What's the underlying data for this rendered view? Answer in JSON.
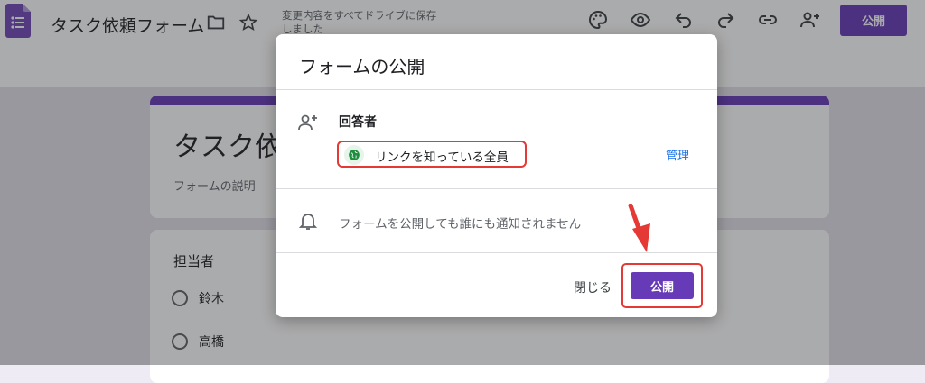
{
  "header": {
    "app_title": "タスク依頼フォーム",
    "save_status": "変更内容をすべてドライブに保存しました",
    "publish_label": "公開"
  },
  "form": {
    "title": "タスク依",
    "description": "フォームの説明",
    "question": {
      "title": "担当者",
      "options": [
        "鈴木",
        "高橋"
      ]
    }
  },
  "dialog": {
    "title": "フォームの公開",
    "responders_label": "回答者",
    "link_access": "リンクを知っている全員",
    "manage_label": "管理",
    "notify_text": "フォームを公開しても誰にも通知されません",
    "close_label": "閉じる",
    "publish_label": "公開"
  },
  "colors": {
    "accent": "#673ab7",
    "highlight": "#e53935",
    "link": "#1a73e8"
  }
}
